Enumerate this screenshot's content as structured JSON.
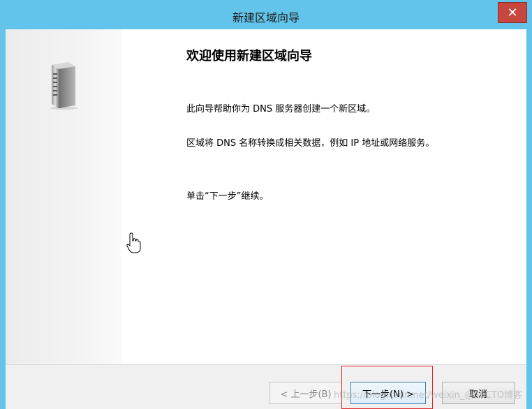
{
  "window": {
    "title": "新建区域向导",
    "close_glyph": "✕"
  },
  "wizard": {
    "heading": "欢迎使用新建区域向导",
    "paragraphs": [
      "此向导帮助你为 DNS 服务器创建一个新区域。",
      "区域将 DNS 名称转换成相关数据，例如 IP 地址或网络服务。",
      "单击“下一步”继续。"
    ],
    "icon": "server-icon"
  },
  "buttons": {
    "back": "< 上一步(B)",
    "next": "下一步(N) >",
    "cancel": "取消"
  },
  "watermark": "https://blog.csdn.net/weixin_@51CTO博客",
  "colors": {
    "titlebar": "#62c4ea",
    "close": "#c7463d",
    "highlight_box": "#e0282e"
  }
}
